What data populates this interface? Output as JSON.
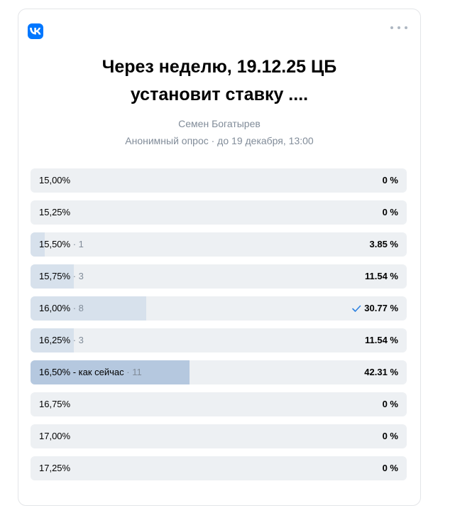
{
  "poll": {
    "logo_icon": "vk-logo-icon",
    "menu_icon": "more-horizontal-icon",
    "title_line1": "Через неделю, 19.12.25 ЦБ",
    "title_line2": "установит ставку ....",
    "author": "Семен Богатырев",
    "meta": "Анонимный опрос · до 19 декабря, 13:00",
    "options": [
      {
        "label": "15,00%",
        "count": "",
        "percent": "0 %",
        "fraction": 0,
        "voted": false,
        "top": false
      },
      {
        "label": "15,25%",
        "count": "",
        "percent": "0 %",
        "fraction": 0,
        "voted": false,
        "top": false
      },
      {
        "label": "15,50%",
        "count": " · 1",
        "percent": "3.85 %",
        "fraction": 0.0385,
        "voted": false,
        "top": false
      },
      {
        "label": "15,75%",
        "count": " · 3",
        "percent": "11.54 %",
        "fraction": 0.1154,
        "voted": false,
        "top": false
      },
      {
        "label": "16,00%",
        "count": " · 8",
        "percent": "30.77 %",
        "fraction": 0.3077,
        "voted": true,
        "top": false
      },
      {
        "label": "16,25%",
        "count": " · 3",
        "percent": "11.54 %",
        "fraction": 0.1154,
        "voted": false,
        "top": false
      },
      {
        "label": "16,50% - как сейчас",
        "count": " · 11",
        "percent": "42.31 %",
        "fraction": 0.4231,
        "voted": false,
        "top": true
      },
      {
        "label": "16,75%",
        "count": "",
        "percent": "0 %",
        "fraction": 0,
        "voted": false,
        "top": false
      },
      {
        "label": "17,00%",
        "count": "",
        "percent": "0 %",
        "fraction": 0,
        "voted": false,
        "top": false
      },
      {
        "label": "17,25%",
        "count": "",
        "percent": "0 %",
        "fraction": 0,
        "voted": false,
        "top": false
      }
    ],
    "colors": {
      "accent": "#0077ff",
      "option_bg": "#edf0f3",
      "fill": "#d7e1ec",
      "fill_top": "#b5c8df",
      "muted_text": "#818c99",
      "check": "#2d81e0"
    }
  }
}
